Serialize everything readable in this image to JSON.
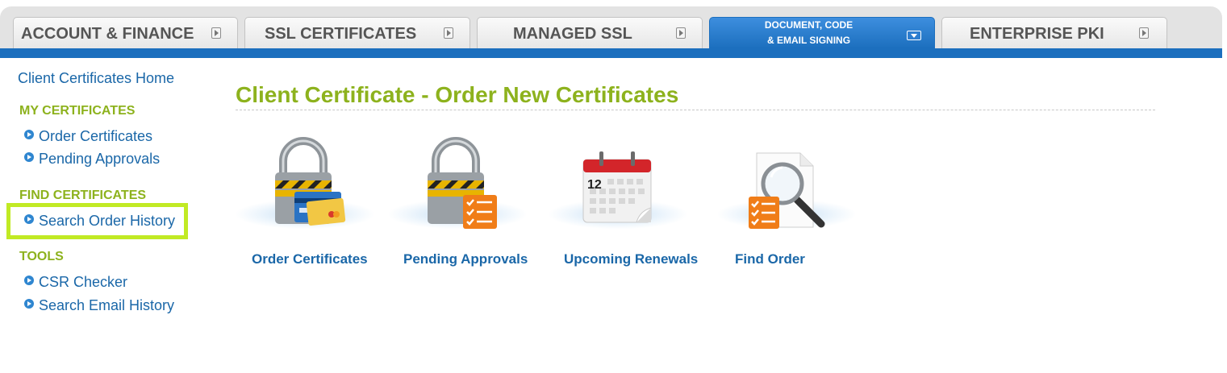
{
  "tabs": [
    {
      "label": "ACCOUNT & FINANCE",
      "active": false
    },
    {
      "label": "SSL CERTIFICATES",
      "active": false
    },
    {
      "label": "MANAGED SSL",
      "active": false
    },
    {
      "label": "DOCUMENT, CODE & EMAIL SIGNING",
      "line1": "DOCUMENT, CODE",
      "line2": "& EMAIL SIGNING",
      "active": true
    },
    {
      "label": "ENTERPRISE PKI",
      "active": false
    }
  ],
  "sidebar": {
    "home": "Client Certificates Home",
    "sections": [
      {
        "heading": "MY CERTIFICATES",
        "items": [
          "Order Certificates",
          "Pending Approvals"
        ]
      },
      {
        "heading": "FIND CERTIFICATES",
        "items": [
          "Search Order History"
        ]
      },
      {
        "heading": "TOOLS",
        "items": [
          "CSR Checker",
          "Search Email History"
        ]
      }
    ],
    "highlighted_item": "Search Order History"
  },
  "main": {
    "title": "Client Certificate - Order New Certificates",
    "tiles": [
      {
        "label": "Order Certificates",
        "icon": "padlock-credit-card-icon"
      },
      {
        "label": "Pending Approvals",
        "icon": "padlock-checklist-icon"
      },
      {
        "label": "Upcoming Renewals",
        "icon": "calendar-icon",
        "calendar_day": "12"
      },
      {
        "label": "Find Order",
        "icon": "magnifier-document-icon"
      }
    ]
  },
  "colors": {
    "accent_green": "#8db21d",
    "link_blue": "#1a67a8",
    "tab_blue": "#1c6fbe",
    "highlight_green": "#c1ea24"
  }
}
